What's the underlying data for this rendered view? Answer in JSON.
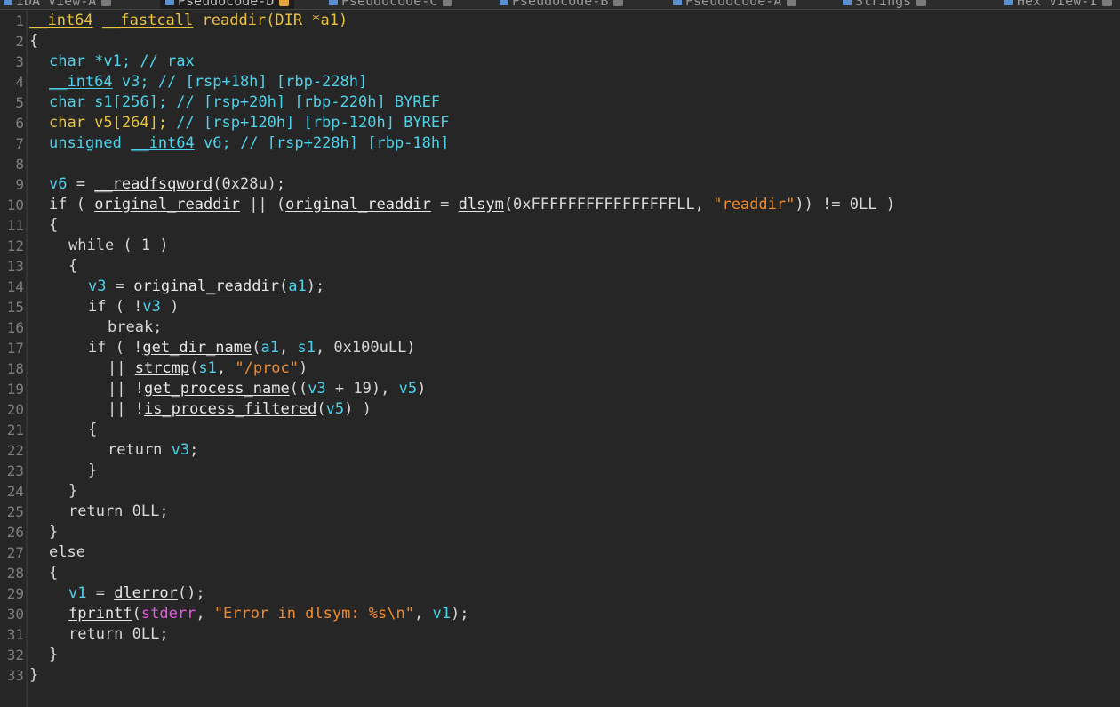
{
  "tabs": [
    {
      "label": "IDA View-A",
      "active": false
    },
    {
      "label": "Pseudocode-D",
      "active": true
    },
    {
      "label": "Pseudocode-C",
      "active": false
    },
    {
      "label": "Pseudocode-B",
      "active": false
    },
    {
      "label": "Pseudocode-A",
      "active": false
    },
    {
      "label": "Strings",
      "active": false
    },
    {
      "label": "Hex View-1",
      "active": false
    }
  ],
  "colors": {
    "background": "#262626",
    "default_text": "#d7d7d7",
    "type_keyword": "#e9c23f",
    "comment": "#4fd1e9",
    "variable": "#4fd1e9",
    "string": "#f08a2c",
    "global": "#e05be0",
    "line_number": "#7e7e7e",
    "active_tab_close": "#e8a23c"
  },
  "code": {
    "lines": [
      {
        "n": "1",
        "indent": 0,
        "tokens": [
          [
            "t-type t-ul",
            "__int64"
          ],
          [
            "t-default",
            " "
          ],
          [
            "t-type t-ul",
            "__fastcall"
          ],
          [
            "t-type",
            " readdir(DIR *a1)"
          ]
        ]
      },
      {
        "n": "2",
        "indent": 0,
        "tokens": [
          [
            "t-default",
            "{"
          ]
        ]
      },
      {
        "n": "3",
        "indent": 1,
        "tokens": [
          [
            "t-comment",
            "char *v1; // rax"
          ]
        ]
      },
      {
        "n": "4",
        "indent": 1,
        "tokens": [
          [
            "t-comment t-ul",
            "__int64"
          ],
          [
            "t-comment",
            " v3; // [rsp+18h] [rbp-228h]"
          ]
        ]
      },
      {
        "n": "5",
        "indent": 1,
        "tokens": [
          [
            "t-comment",
            "char s1[256]; // [rsp+20h] [rbp-220h] BYREF"
          ]
        ]
      },
      {
        "n": "6",
        "indent": 1,
        "tokens": [
          [
            "t-type",
            "char v5[264]; "
          ],
          [
            "t-comment",
            "// [rsp+120h] [rbp-120h] BYREF"
          ]
        ]
      },
      {
        "n": "7",
        "indent": 1,
        "tokens": [
          [
            "t-comment",
            "unsigned "
          ],
          [
            "t-comment t-ul",
            "__int64"
          ],
          [
            "t-comment",
            " v6; // [rsp+228h] [rbp-18h]"
          ]
        ]
      },
      {
        "n": "8",
        "indent": 0,
        "tokens": []
      },
      {
        "n": "9",
        "indent": 1,
        "tokens": [
          [
            "t-var",
            "v6"
          ],
          [
            "t-default",
            " = "
          ],
          [
            "t-func t-ul",
            "__readfsqword"
          ],
          [
            "t-default",
            "(0x28u);"
          ]
        ]
      },
      {
        "n": "10",
        "indent": 1,
        "tokens": [
          [
            "t-default",
            "if ( "
          ],
          [
            "t-func t-ul",
            "original_readdir"
          ],
          [
            "t-default",
            " || ("
          ],
          [
            "t-func t-ul",
            "original_readdir"
          ],
          [
            "t-default",
            " = "
          ],
          [
            "t-func t-ul",
            "dlsym"
          ],
          [
            "t-default",
            "(0xFFFFFFFFFFFFFFFFLL, "
          ],
          [
            "t-str",
            "\"readdir\""
          ],
          [
            "t-default",
            ")) != 0LL )"
          ]
        ]
      },
      {
        "n": "11",
        "indent": 1,
        "tokens": [
          [
            "t-default",
            "{"
          ]
        ]
      },
      {
        "n": "12",
        "indent": 2,
        "tokens": [
          [
            "t-default",
            "while ( 1 )"
          ]
        ]
      },
      {
        "n": "13",
        "indent": 2,
        "tokens": [
          [
            "t-default",
            "{"
          ]
        ]
      },
      {
        "n": "14",
        "indent": 3,
        "tokens": [
          [
            "t-var",
            "v3"
          ],
          [
            "t-default",
            " = "
          ],
          [
            "t-func t-ul",
            "original_readdir"
          ],
          [
            "t-default",
            "("
          ],
          [
            "t-var",
            "a1"
          ],
          [
            "t-default",
            ");"
          ]
        ]
      },
      {
        "n": "15",
        "indent": 3,
        "tokens": [
          [
            "t-default",
            "if ( !"
          ],
          [
            "t-var",
            "v3"
          ],
          [
            "t-default",
            " )"
          ]
        ]
      },
      {
        "n": "16",
        "indent": 4,
        "tokens": [
          [
            "t-default",
            "break;"
          ]
        ]
      },
      {
        "n": "17",
        "indent": 3,
        "tokens": [
          [
            "t-default",
            "if ( !"
          ],
          [
            "t-func t-ul",
            "get_dir_name"
          ],
          [
            "t-default",
            "("
          ],
          [
            "t-var",
            "a1"
          ],
          [
            "t-default",
            ", "
          ],
          [
            "t-var",
            "s1"
          ],
          [
            "t-default",
            ", 0x100uLL)"
          ]
        ]
      },
      {
        "n": "18",
        "indent": 4,
        "tokens": [
          [
            "t-default",
            "|| "
          ],
          [
            "t-func t-ul",
            "strcmp"
          ],
          [
            "t-default",
            "("
          ],
          [
            "t-var",
            "s1"
          ],
          [
            "t-default",
            ", "
          ],
          [
            "t-str",
            "\"/proc\""
          ],
          [
            "t-default",
            ")"
          ]
        ]
      },
      {
        "n": "19",
        "indent": 4,
        "tokens": [
          [
            "t-default",
            "|| !"
          ],
          [
            "t-func t-ul",
            "get_process_name"
          ],
          [
            "t-default",
            "(("
          ],
          [
            "t-var",
            "v3"
          ],
          [
            "t-default",
            " + 19), "
          ],
          [
            "t-var",
            "v5"
          ],
          [
            "t-default",
            ")"
          ]
        ]
      },
      {
        "n": "20",
        "indent": 4,
        "tokens": [
          [
            "t-default",
            "|| !"
          ],
          [
            "t-func t-ul",
            "is_process_filtered"
          ],
          [
            "t-default",
            "("
          ],
          [
            "t-var",
            "v5"
          ],
          [
            "t-default",
            ") )"
          ]
        ]
      },
      {
        "n": "21",
        "indent": 3,
        "tokens": [
          [
            "t-default",
            "{"
          ]
        ]
      },
      {
        "n": "22",
        "indent": 4,
        "tokens": [
          [
            "t-default",
            "return "
          ],
          [
            "t-var",
            "v3"
          ],
          [
            "t-default",
            ";"
          ]
        ]
      },
      {
        "n": "23",
        "indent": 3,
        "tokens": [
          [
            "t-default",
            "}"
          ]
        ]
      },
      {
        "n": "24",
        "indent": 2,
        "tokens": [
          [
            "t-default",
            "}"
          ]
        ]
      },
      {
        "n": "25",
        "indent": 2,
        "tokens": [
          [
            "t-default",
            "return 0LL;"
          ]
        ]
      },
      {
        "n": "26",
        "indent": 1,
        "tokens": [
          [
            "t-default",
            "}"
          ]
        ]
      },
      {
        "n": "27",
        "indent": 1,
        "tokens": [
          [
            "t-default",
            "else"
          ]
        ]
      },
      {
        "n": "28",
        "indent": 1,
        "tokens": [
          [
            "t-default",
            "{"
          ]
        ]
      },
      {
        "n": "29",
        "indent": 2,
        "tokens": [
          [
            "t-var",
            "v1"
          ],
          [
            "t-default",
            " = "
          ],
          [
            "t-func t-ul",
            "dlerror"
          ],
          [
            "t-default",
            "();"
          ]
        ]
      },
      {
        "n": "30",
        "indent": 2,
        "tokens": [
          [
            "t-func t-ul",
            "fprintf"
          ],
          [
            "t-default",
            "("
          ],
          [
            "t-global",
            "stderr"
          ],
          [
            "t-default",
            ", "
          ],
          [
            "t-str",
            "\"Error in dlsym: %s\\n\""
          ],
          [
            "t-default",
            ", "
          ],
          [
            "t-var",
            "v1"
          ],
          [
            "t-default",
            ");"
          ]
        ]
      },
      {
        "n": "31",
        "indent": 2,
        "tokens": [
          [
            "t-default",
            "return 0LL;"
          ]
        ]
      },
      {
        "n": "32",
        "indent": 1,
        "tokens": [
          [
            "t-default",
            "}"
          ]
        ]
      },
      {
        "n": "33",
        "indent": 0,
        "tokens": [
          [
            "t-default",
            "}"
          ]
        ]
      }
    ]
  }
}
